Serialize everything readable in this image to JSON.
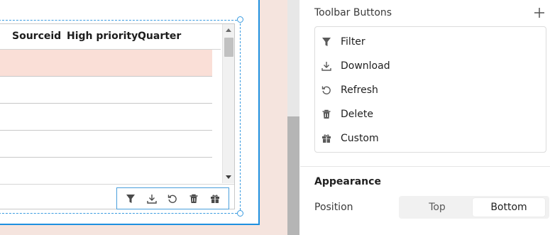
{
  "table": {
    "columns": [
      "Sourceid",
      "High priority",
      "Quarter"
    ],
    "rows": [
      {
        "highlighted": true
      },
      {
        "highlighted": false
      },
      {
        "highlighted": false
      },
      {
        "highlighted": false
      },
      {
        "highlighted": false
      }
    ],
    "toolbar_icons": [
      "filter-icon",
      "download-icon",
      "refresh-icon",
      "delete-icon",
      "custom-icon"
    ]
  },
  "panel": {
    "toolbar_title": "Toolbar Buttons",
    "items": [
      {
        "label": "Filter",
        "icon": "filter-icon"
      },
      {
        "label": "Download",
        "icon": "download-icon"
      },
      {
        "label": "Refresh",
        "icon": "refresh-icon"
      },
      {
        "label": "Delete",
        "icon": "delete-icon"
      },
      {
        "label": "Custom",
        "icon": "custom-icon"
      }
    ],
    "appearance_title": "Appearance",
    "position_label": "Position",
    "position_options": [
      "Top",
      "Bottom"
    ],
    "position_selected": "Bottom"
  },
  "colors": {
    "selection_blue": "#1e90e0",
    "canvas_bg": "#f5e4de",
    "row_highlight": "#fadfd7"
  }
}
